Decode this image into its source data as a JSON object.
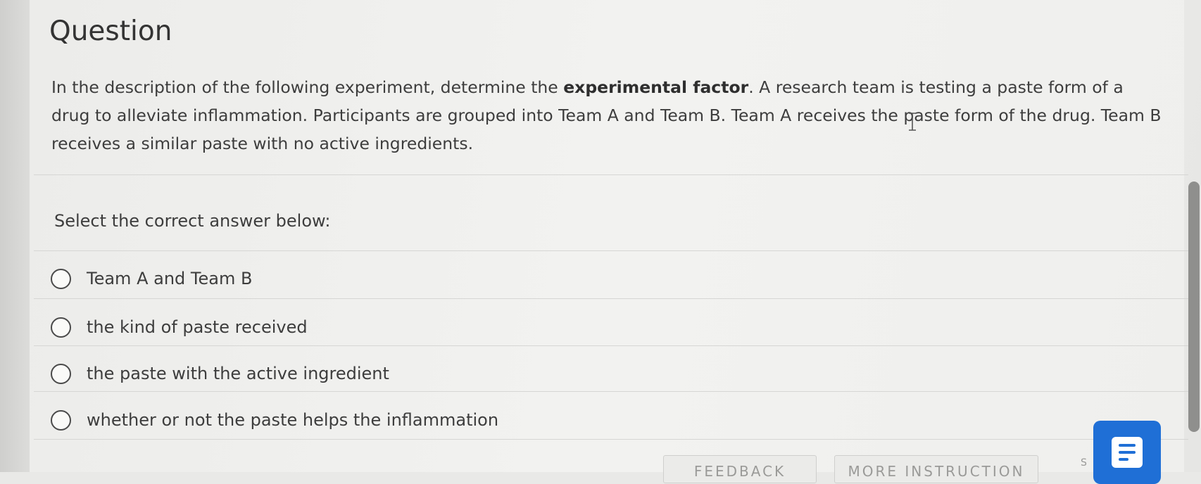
{
  "question": {
    "title": "Question",
    "prompt_part1": "In the description of the following experiment, determine the ",
    "prompt_bold": "experimental factor",
    "prompt_part2": ". A research team is testing a paste form of a drug to alleviate inflammation. Participants are grouped into Team A and Team B. Team A receives the paste form of the drug. Team B receives a similar paste with no active ingredients."
  },
  "instruction": "Select the correct answer below:",
  "options": [
    {
      "label": "Team A and Team B"
    },
    {
      "label": "the kind of paste received"
    },
    {
      "label": "the paste with the active ingredient"
    },
    {
      "label": "whether or not the paste helps the inflammation"
    }
  ],
  "footer": {
    "feedback_label": "FEEDBACK",
    "more_instruction_label": "MORE INSTRUCTION",
    "submit_fragment": "S"
  },
  "icons": {
    "chat": "chat-lines-icon",
    "cursor": "text-cursor-icon"
  },
  "colors": {
    "accent": "#1f6fd6"
  }
}
